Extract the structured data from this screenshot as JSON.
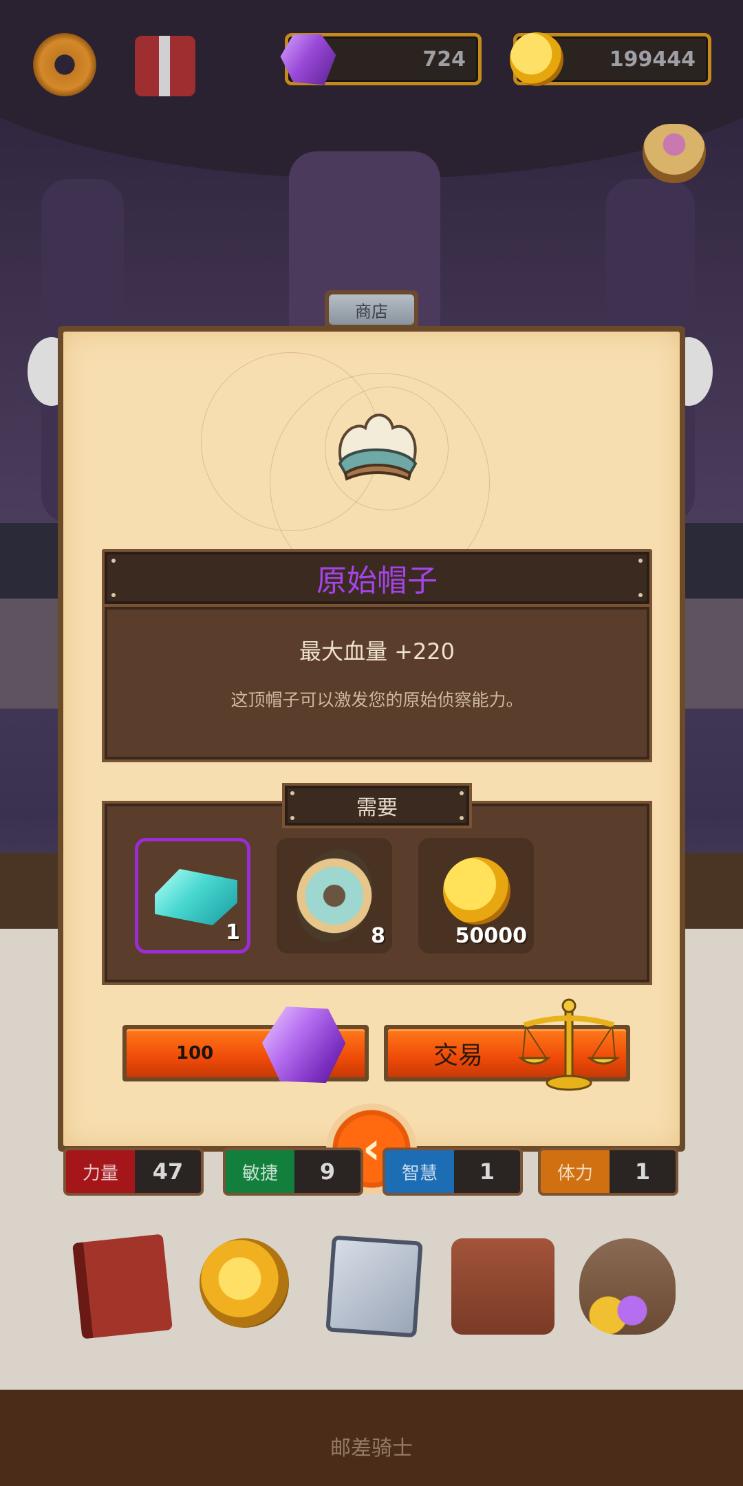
{
  "currency": {
    "gems": "724",
    "coins": "199444"
  },
  "icons": {
    "settings": "gear-icon",
    "gift": "gift-box-icon",
    "gem": "purple-gem-icon",
    "coin": "gold-coin-icon",
    "bag": "loot-bag-icon"
  },
  "shop": {
    "tab_label": "商店",
    "item_name": "原始帽子",
    "item_stat": "最大血量 +220",
    "item_description": "这顶帽子可以激发您的原始侦察能力。",
    "requirements_label": "需要",
    "requirements": [
      {
        "icon": "crystal-ingot-icon",
        "count": "1",
        "selected": true
      },
      {
        "icon": "shield-part-icon",
        "count": "8",
        "selected": false
      },
      {
        "icon": "gold-coin-icon",
        "count": "50000",
        "selected": false
      }
    ],
    "buy_button": {
      "label": "100",
      "icon": "purple-gem-icon"
    },
    "trade_button": {
      "label": "交易",
      "icon": "balance-scale-icon"
    },
    "back_button": {
      "label": "‹",
      "icon": "back-arrow-icon"
    }
  },
  "stats": [
    {
      "label": "力量",
      "value": "47",
      "color": "#a5161b"
    },
    {
      "label": "敏捷",
      "value": "9",
      "color": "#137f3d"
    },
    {
      "label": "智慧",
      "value": "1",
      "color": "#1d6db5"
    },
    {
      "label": "体力",
      "value": "1",
      "color": "#d17010"
    }
  ],
  "menu": [
    {
      "name": "spellbook",
      "icon": "spellbook-icon"
    },
    {
      "name": "medal",
      "icon": "star-medal-icon"
    },
    {
      "name": "cards",
      "icon": "cards-icon"
    },
    {
      "name": "backpack",
      "icon": "backpack-icon"
    },
    {
      "name": "treasure",
      "icon": "treasure-bag-icon"
    }
  ],
  "footer": {
    "title": "邮差骑士"
  }
}
